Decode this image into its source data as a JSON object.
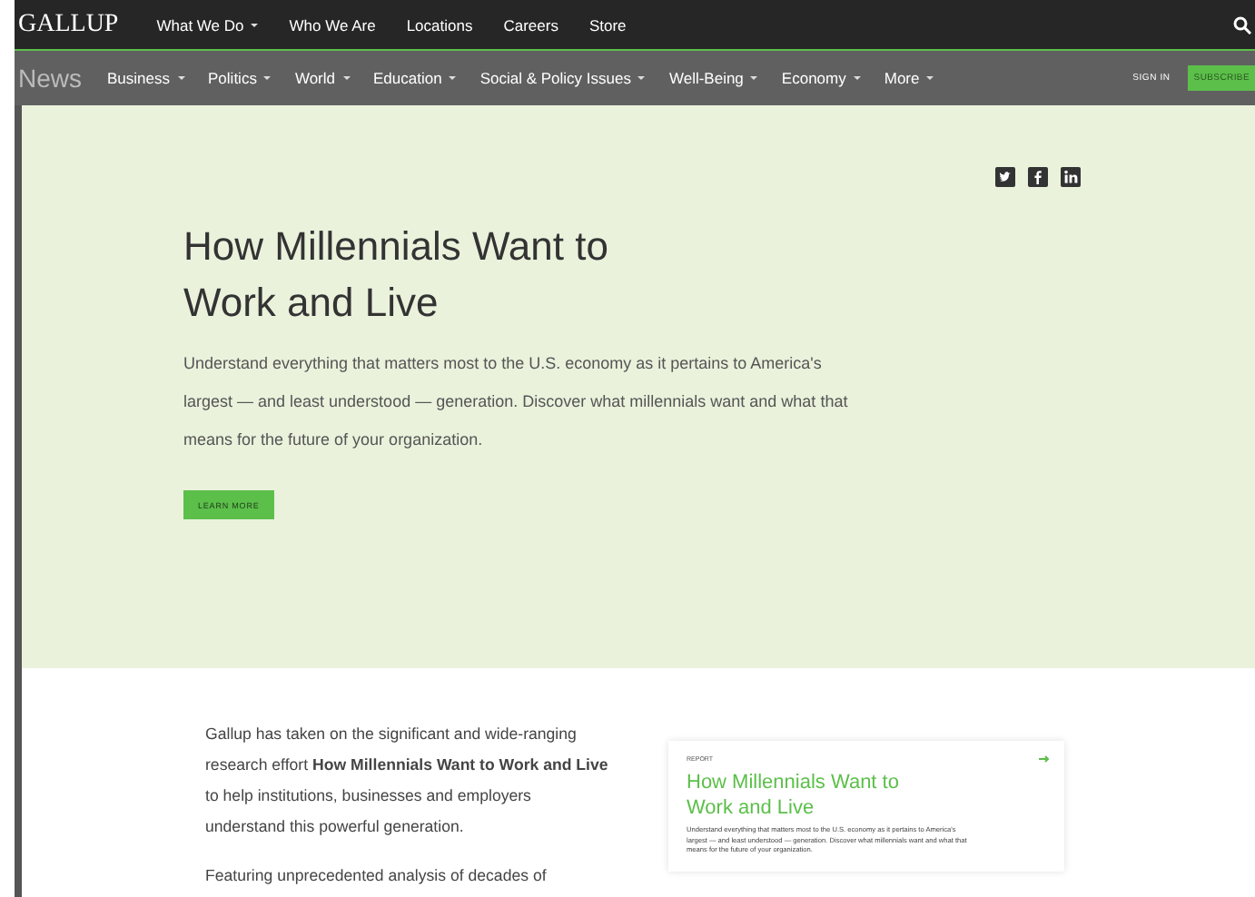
{
  "top_nav": {
    "logo": "GALLUP",
    "items": [
      {
        "label": "What We Do",
        "has_menu": true
      },
      {
        "label": "Who We Are",
        "has_menu": false
      },
      {
        "label": "Locations",
        "has_menu": false
      },
      {
        "label": "Careers",
        "has_menu": false
      },
      {
        "label": "Store",
        "has_menu": false
      }
    ]
  },
  "sub_nav": {
    "section": "News",
    "items": [
      {
        "label": "Business",
        "has_menu": true
      },
      {
        "label": "Politics",
        "has_menu": true
      },
      {
        "label": "World",
        "has_menu": true
      },
      {
        "label": "Education",
        "has_menu": true
      },
      {
        "label": "Social & Policy Issues",
        "has_menu": true
      },
      {
        "label": "Well-Being",
        "has_menu": true
      },
      {
        "label": "Economy",
        "has_menu": true
      },
      {
        "label": "More",
        "has_menu": true
      }
    ],
    "sign_in": "SIGN IN",
    "subscribe": "SUBSCRIBE"
  },
  "hero": {
    "title": "How Millennials Want to Work and Live",
    "text": "Understand everything that matters most to the U.S. economy as it pertains to America's largest — and least understood — generation. Discover what millennials want and what that means for the future of your organization.",
    "button": "LEARN MORE"
  },
  "body": {
    "paragraphs": [
      "Gallup has taken on the significant and wide-ranging research effort **How Millennials Want to Work and Live** to help institutions, businesses and employers understand this powerful generation.",
      "Featuring unprecedented analysis of decades of"
    ]
  },
  "report_card": {
    "label": "REPORT",
    "title": "How Millennials Want to Work and Live",
    "text": "Understand everything that matters most to the U.S. economy as it pertains to America's largest — and least understood — generation. Discover what millennials want and what that means for the future of your organization."
  }
}
